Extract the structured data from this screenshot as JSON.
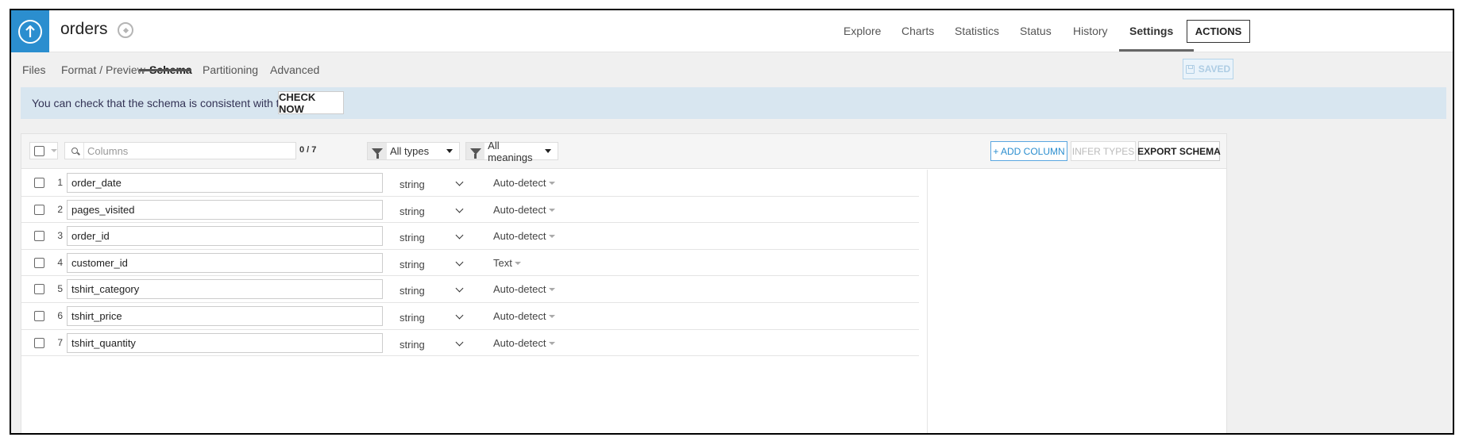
{
  "header": {
    "dataset_name": "orders",
    "nav": [
      "Explore",
      "Charts",
      "Statistics",
      "Status",
      "History",
      "Settings"
    ],
    "actions_label": "ACTIONS"
  },
  "subnav": {
    "tabs": [
      "Files",
      "Format / Preview",
      "Schema",
      "Partitioning",
      "Advanced"
    ],
    "active_tab": "Schema",
    "saved_label": "SAVED"
  },
  "banner": {
    "text": "You can check that the schema is consistent with the dataset.",
    "button_label": "CHECK NOW"
  },
  "toolbar": {
    "search_placeholder": "Columns",
    "count": "0 / 7",
    "types_filter": "All types",
    "meanings_filter": "All meanings",
    "add_column": "+ ADD COLUMN",
    "infer_types": "INFER TYPES",
    "export_schema": "EXPORT SCHEMA"
  },
  "columns": [
    {
      "num": "1",
      "name": "order_date",
      "type": "string",
      "meaning": "Auto-detect"
    },
    {
      "num": "2",
      "name": "pages_visited",
      "type": "string",
      "meaning": "Auto-detect"
    },
    {
      "num": "3",
      "name": "order_id",
      "type": "string",
      "meaning": "Auto-detect"
    },
    {
      "num": "4",
      "name": "customer_id",
      "type": "string",
      "meaning": "Text"
    },
    {
      "num": "5",
      "name": "tshirt_category",
      "type": "string",
      "meaning": "Auto-detect"
    },
    {
      "num": "6",
      "name": "tshirt_price",
      "type": "string",
      "meaning": "Auto-detect"
    },
    {
      "num": "7",
      "name": "tshirt_quantity",
      "type": "string",
      "meaning": "Auto-detect"
    }
  ],
  "colors": {
    "brand_blue": "#2b8ecf",
    "banner_bg": "#d8e6f0"
  }
}
